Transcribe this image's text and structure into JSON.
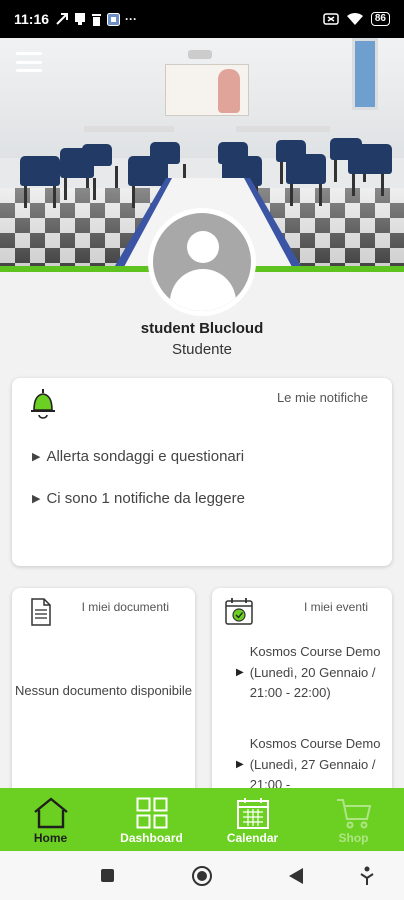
{
  "status_bar": {
    "time": "11:16",
    "dots": "···",
    "battery": "86"
  },
  "hero": {
    "menu_icon": "hamburger-menu-icon"
  },
  "profile": {
    "name": "student Blucloud",
    "role": "Studente",
    "avatar_icon": "user-avatar-icon"
  },
  "notifications": {
    "title": "Le mie notifiche",
    "icon": "bell-icon",
    "items": [
      "Allerta sondaggi e questionari",
      "Ci sono 1 notifiche da leggere"
    ]
  },
  "documents": {
    "title": "I miei documenti",
    "icon": "document-icon",
    "empty_text": "Nessun documento disponibile"
  },
  "events": {
    "title": "I miei eventi",
    "icon": "calendar-check-icon",
    "items": [
      "Kosmos Course Demo (Lunedì, 20 Gennaio / 21:00 - 22:00)",
      "Kosmos Course Demo (Lunedì, 27 Gennaio / 21:00 -"
    ]
  },
  "bottom_nav": {
    "items": [
      {
        "label": "Home",
        "icon": "home-icon"
      },
      {
        "label": "Dashboard",
        "icon": "dashboard-grid-icon"
      },
      {
        "label": "Calendar",
        "icon": "calendar-icon"
      },
      {
        "label": "Shop",
        "icon": "cart-icon"
      }
    ]
  },
  "colors": {
    "accent_green": "#6bd021",
    "hero_green_line": "#5ec21f"
  }
}
